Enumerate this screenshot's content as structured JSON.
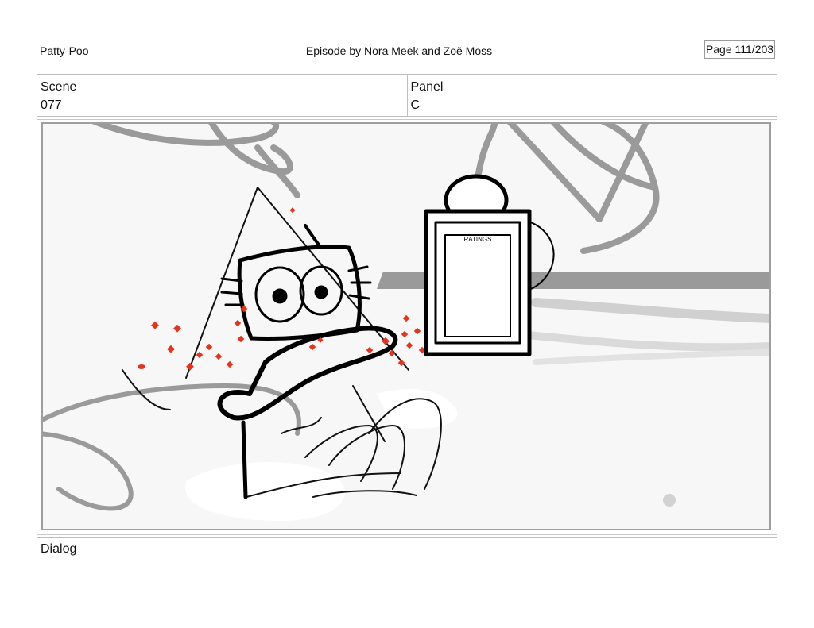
{
  "header": {
    "show_title": "Patty-Poo",
    "episode_credit": "Episode by Nora Meek and Zoë Moss",
    "page_label": "Page 111/203"
  },
  "info": {
    "scene_label": "Scene",
    "scene_value": "077",
    "panel_label": "Panel",
    "panel_value": "C"
  },
  "sketch": {
    "sign_text": "RATINGS",
    "colors": {
      "ink": "#000000",
      "grey_lines": "#9a9a9a",
      "splatter": "#e8331a",
      "background": "#f7f7f7"
    }
  },
  "dialog": {
    "label": "Dialog",
    "text": ""
  }
}
